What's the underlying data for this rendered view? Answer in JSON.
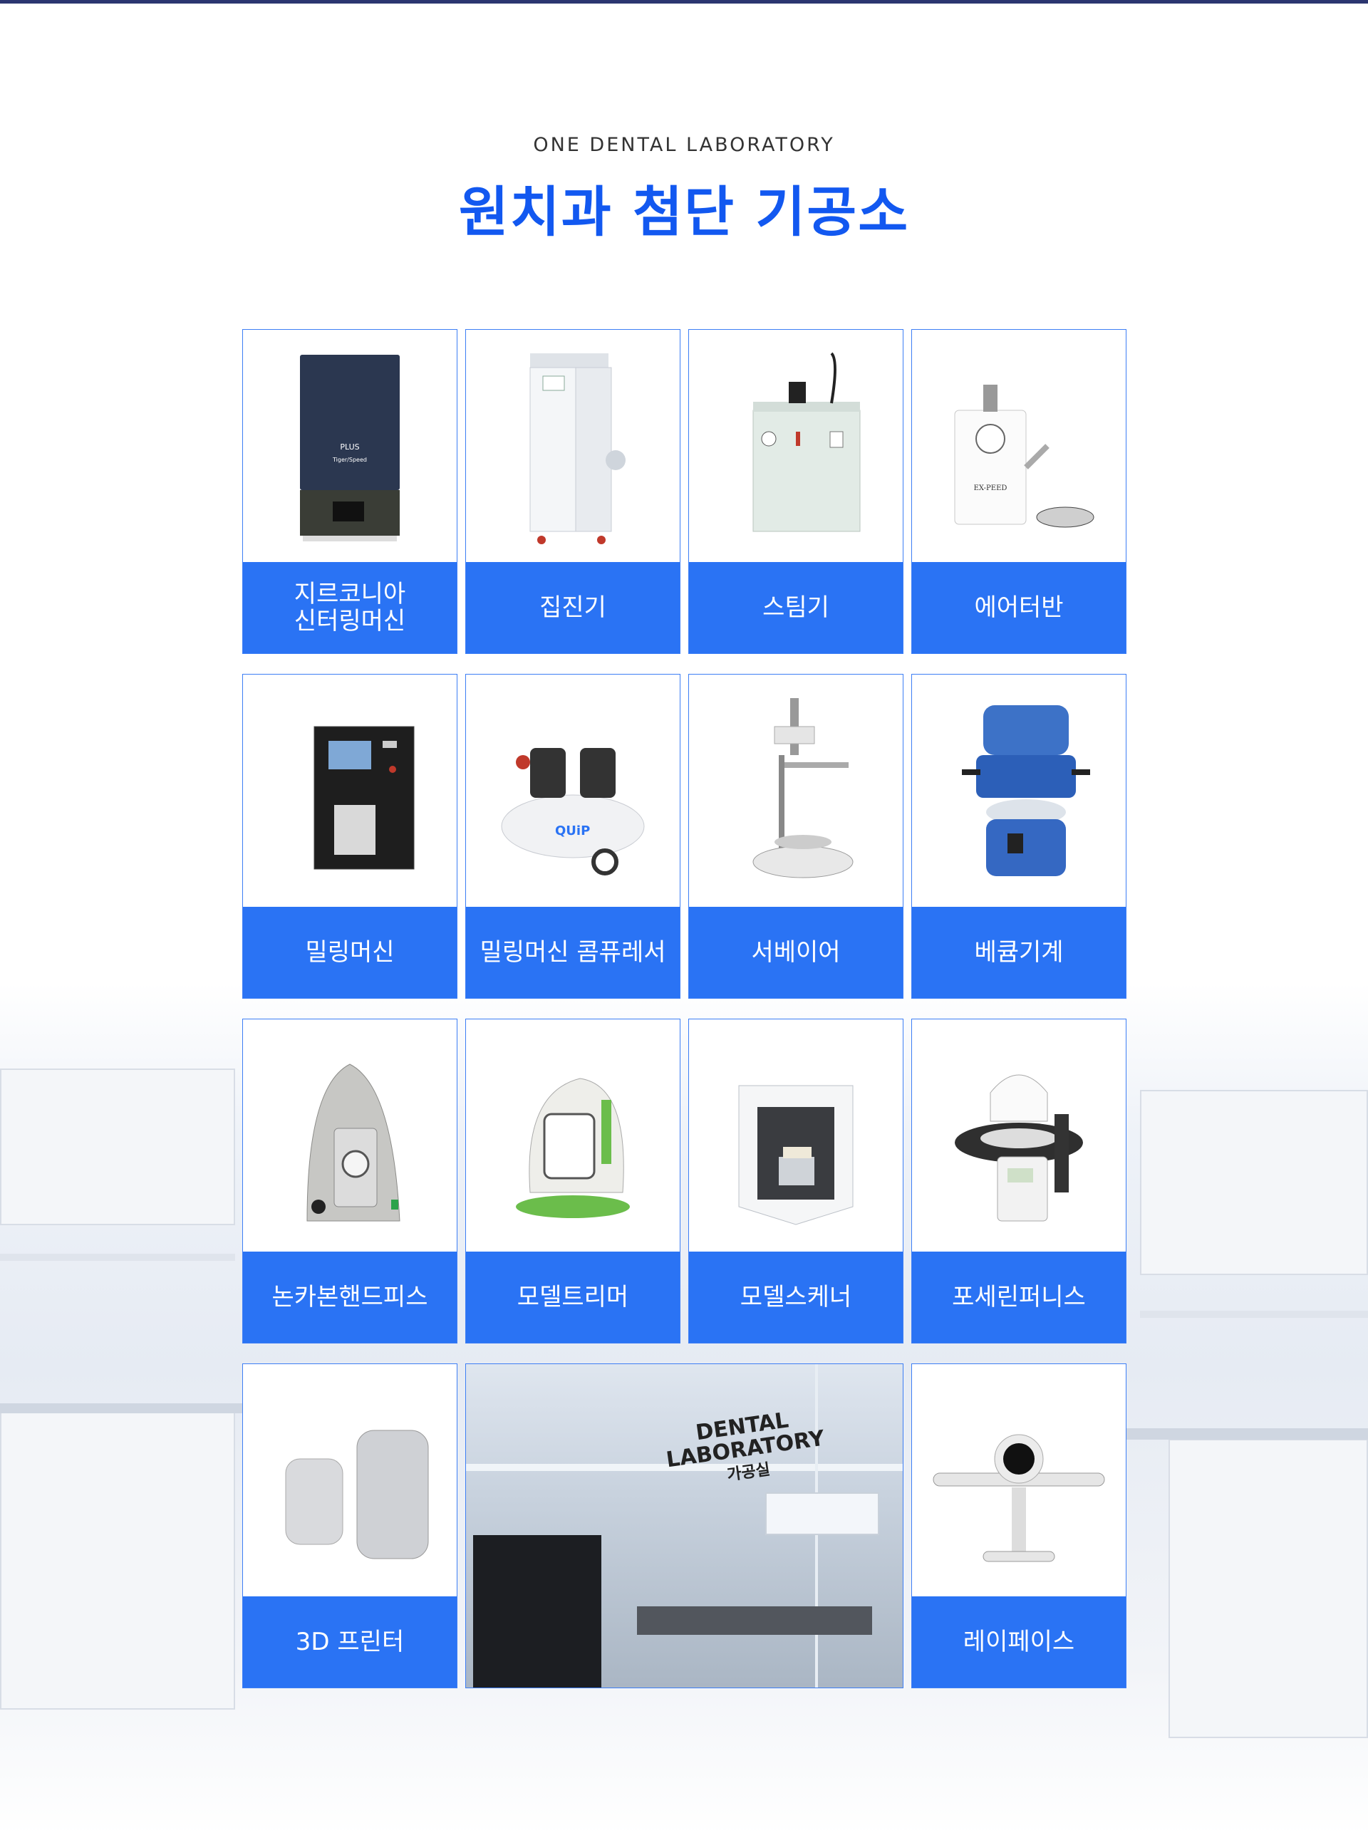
{
  "header": {
    "eyebrow": "ONE DENTAL LABORATORY",
    "title": "원치과 첨단 기공소"
  },
  "colors": {
    "accent": "#1258f0",
    "label_bg": "#2a73f4",
    "border": "#3d7ef5"
  },
  "equipment": [
    {
      "label": "지르코니아\n신터링머신",
      "icon": "sintering-furnace-icon"
    },
    {
      "label": "집진기",
      "icon": "dust-collector-icon"
    },
    {
      "label": "스팀기",
      "icon": "steam-cleaner-icon"
    },
    {
      "label": "에어터반",
      "icon": "air-turbine-icon"
    },
    {
      "label": "밀링머신",
      "icon": "milling-machine-icon"
    },
    {
      "label": "밀링머신 콤퓨레서",
      "icon": "compressor-icon"
    },
    {
      "label": "서베이어",
      "icon": "surveyor-icon"
    },
    {
      "label": "베큠기계",
      "icon": "vacuum-mixer-icon"
    },
    {
      "label": "논카본핸드피스",
      "icon": "handpiece-icon"
    },
    {
      "label": "모델트리머",
      "icon": "model-trimmer-icon"
    },
    {
      "label": "모델스케너",
      "icon": "model-scanner-icon"
    },
    {
      "label": "포세린퍼니스",
      "icon": "porcelain-furnace-icon"
    },
    {
      "label": "3D 프린터",
      "icon": "3d-printer-icon"
    },
    {
      "label": "레이페이스",
      "icon": "rayface-scanner-icon"
    }
  ],
  "lab_photo": {
    "sign_line1": "DENTAL",
    "sign_line2": "LABORATORY",
    "sign_sub": "가공실"
  }
}
